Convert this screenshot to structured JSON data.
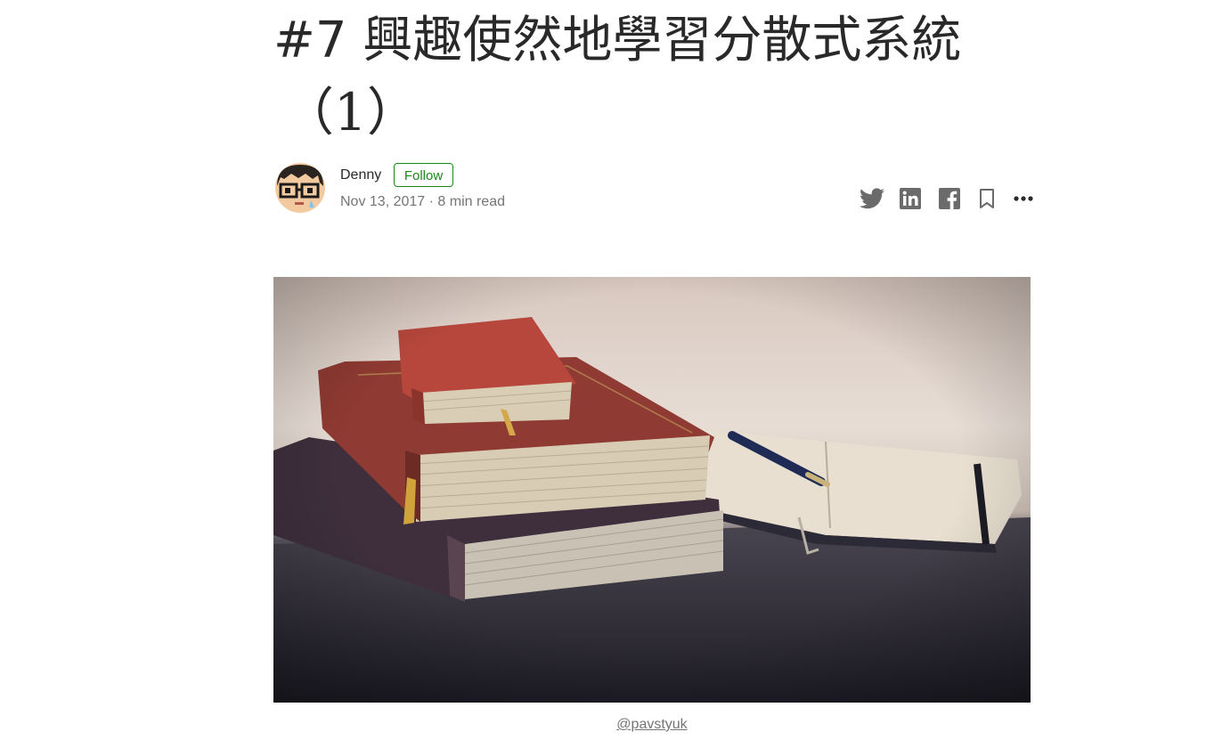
{
  "article": {
    "title_line1": "#7 興趣使然地學習分散式系統",
    "title_line2": "（1）"
  },
  "author": {
    "name": "Denny",
    "follow_label": "Follow",
    "meta": "Nov 13, 2017 · 8 min read"
  },
  "share": {
    "icons": [
      "twitter-icon",
      "linkedin-icon",
      "facebook-icon",
      "bookmark-icon",
      "more-icon"
    ],
    "icon_color": "#757575"
  },
  "hero": {
    "caption": "@pavstyuk"
  },
  "colors": {
    "follow_green": "#1a8917",
    "text_dark": "#292929",
    "text_muted": "#757575"
  }
}
